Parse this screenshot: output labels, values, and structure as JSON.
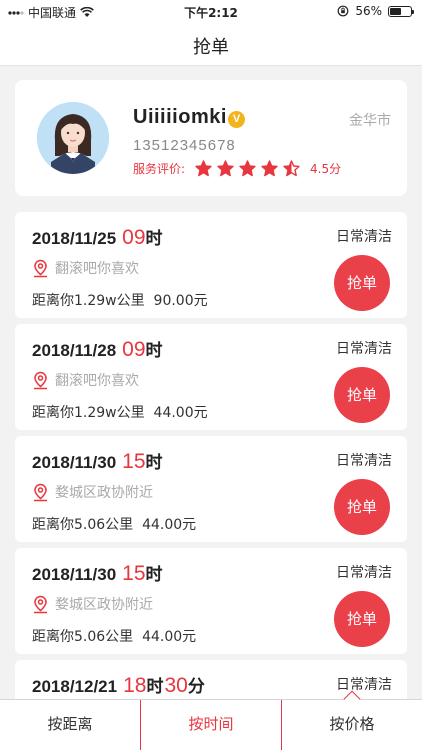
{
  "status_bar": {
    "carrier": "中国联通",
    "time": "下午2:12",
    "battery": "56%",
    "battery_level": 0.56
  },
  "nav": {
    "title": "抢单"
  },
  "profile": {
    "name": "Uiiiiiomki",
    "verified_badge": "V",
    "phone": "13512345678",
    "rating_label": "服务评价:",
    "rating_value": 4.5,
    "rating_text": "4.5分",
    "city": "金华市"
  },
  "orders": [
    {
      "date": "2018/11/25",
      "hour": "09",
      "hour_unit": "时",
      "minute": "",
      "minute_unit": "",
      "type": "日常清洁",
      "address": "翻滚吧你喜欢",
      "distance": "距离你1.29w公里",
      "price": "90.00元",
      "button": "抢单"
    },
    {
      "date": "2018/11/28",
      "hour": "09",
      "hour_unit": "时",
      "minute": "",
      "minute_unit": "",
      "type": "日常清洁",
      "address": "翻滚吧你喜欢",
      "distance": "距离你1.29w公里",
      "price": "44.00元",
      "button": "抢单"
    },
    {
      "date": "2018/11/30",
      "hour": "15",
      "hour_unit": "时",
      "minute": "",
      "minute_unit": "",
      "type": "日常清洁",
      "address": "婺城区政协附近",
      "distance": "距离你5.06公里",
      "price": "44.00元",
      "button": "抢单"
    },
    {
      "date": "2018/11/30",
      "hour": "15",
      "hour_unit": "时",
      "minute": "",
      "minute_unit": "",
      "type": "日常清洁",
      "address": "婺城区政协附近",
      "distance": "距离你5.06公里",
      "price": "44.00元",
      "button": "抢单"
    },
    {
      "date": "2018/12/21",
      "hour": "18",
      "hour_unit": "时",
      "minute": "30",
      "minute_unit": "分",
      "type": "日常清洁",
      "address": "",
      "distance": "",
      "price": "",
      "button": ""
    }
  ],
  "tabs": [
    {
      "label": "按距离",
      "active": false
    },
    {
      "label": "按时间",
      "active": true
    },
    {
      "label": "按价格",
      "active": false
    }
  ],
  "colors": {
    "accent": "#e8363f",
    "button": "#e9404a",
    "badge": "#f2b41c"
  }
}
